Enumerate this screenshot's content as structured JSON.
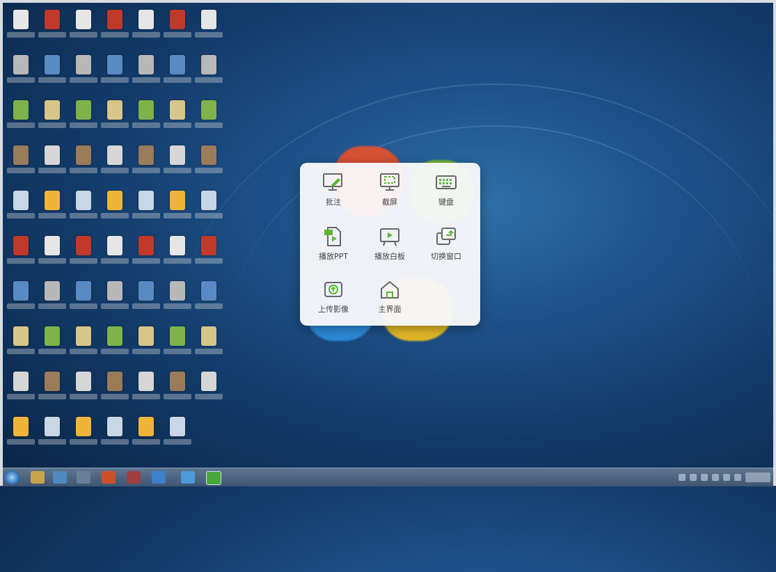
{
  "popup_menu": {
    "items": [
      {
        "label": "批注",
        "icon": "annotate-icon"
      },
      {
        "label": "截屏",
        "icon": "screenshot-icon"
      },
      {
        "label": "键盘",
        "icon": "keyboard-icon"
      },
      {
        "label": "播放PPT",
        "icon": "play-ppt-icon"
      },
      {
        "label": "播放白板",
        "icon": "play-whiteboard-icon"
      },
      {
        "label": "切换窗口",
        "icon": "switch-window-icon"
      },
      {
        "label": "上传影像",
        "icon": "upload-image-icon"
      },
      {
        "label": "主界面",
        "icon": "home-icon"
      }
    ]
  },
  "colors": {
    "accent_green": "#5cb531",
    "icon_gray": "#666666",
    "popup_bg": "#f8f8fa",
    "desktop_blue": "#1d4f86",
    "taskbar": "#4a6380"
  }
}
